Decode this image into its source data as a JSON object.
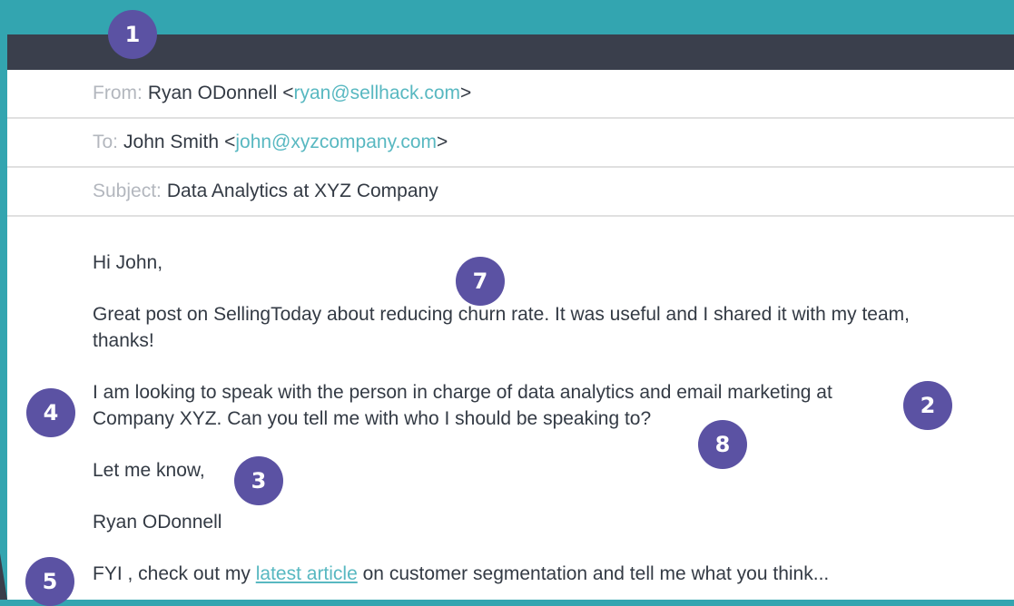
{
  "email": {
    "from": {
      "label": "From:",
      "name": "Ryan ODonnell",
      "open": "<",
      "address": "ryan@sellhack.com",
      "close": ">"
    },
    "to": {
      "label": "To:",
      "name": "John Smith",
      "open": "<",
      "address": "john@xyzcompany.com",
      "close": ">"
    },
    "subject": {
      "label": "Subject:",
      "text": "Data Analytics at XYZ Company"
    },
    "body": {
      "greeting": "Hi John,",
      "paragraph1": "Great post on SellingToday about reducing churn rate. It was useful and I shared it with my team, thanks!",
      "paragraph2": "I am looking to speak with the person in charge of data analytics and email marketing at Company XYZ. Can you tell me with who I should be speaking to?",
      "closing": "Let me know,",
      "signature": "Ryan ODonnell",
      "ps_before": "FYI , check out my",
      "ps_link": "latest article",
      "ps_after": "on customer segmentation and tell me what you think..."
    }
  },
  "badges": [
    "1",
    "2",
    "3",
    "4",
    "5",
    "7",
    "8"
  ],
  "colors": {
    "background_teal": "#33a5b0",
    "titlebar": "#3a3f4c",
    "badge": "#5b52a3",
    "link": "#58b8c1",
    "label_gray": "#b3b7be"
  }
}
